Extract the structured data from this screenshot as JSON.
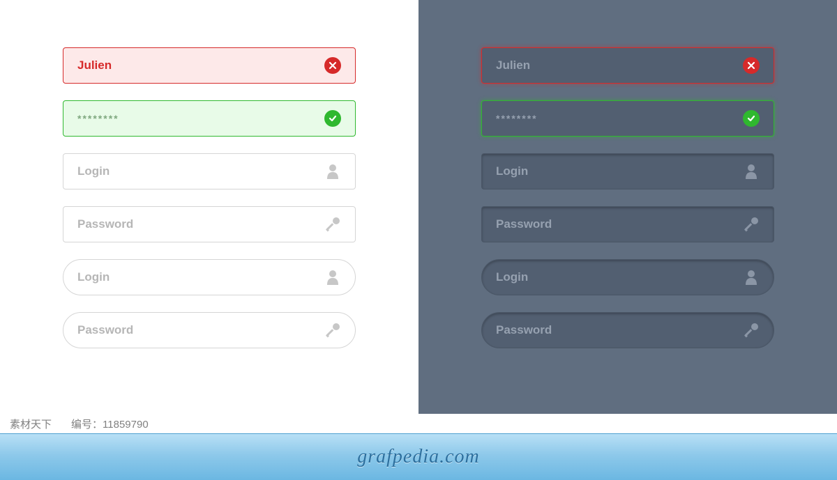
{
  "light_panel": {
    "fields": [
      {
        "value": "Julien",
        "type": "error",
        "icon": "x-icon",
        "shape": "rect"
      },
      {
        "value": "********",
        "type": "success",
        "icon": "check-icon",
        "shape": "rect"
      },
      {
        "value": "Login",
        "type": "neutral",
        "icon": "user-icon",
        "shape": "rect"
      },
      {
        "value": "Password",
        "type": "neutral",
        "icon": "key-icon",
        "shape": "rect"
      },
      {
        "value": "Login",
        "type": "neutral",
        "icon": "user-icon",
        "shape": "round"
      },
      {
        "value": "Password",
        "type": "neutral",
        "icon": "key-icon",
        "shape": "round"
      }
    ]
  },
  "dark_panel": {
    "fields": [
      {
        "value": "Julien",
        "type": "error",
        "icon": "x-icon",
        "shape": "rect"
      },
      {
        "value": "********",
        "type": "success",
        "icon": "check-icon",
        "shape": "rect"
      },
      {
        "value": "Login",
        "type": "neutral",
        "icon": "user-icon",
        "shape": "rect"
      },
      {
        "value": "Password",
        "type": "neutral",
        "icon": "key-icon",
        "shape": "rect"
      },
      {
        "value": "Login",
        "type": "neutral",
        "icon": "user-icon",
        "shape": "round"
      },
      {
        "value": "Password",
        "type": "neutral",
        "icon": "key-icon",
        "shape": "round"
      }
    ]
  },
  "meta": {
    "source_label": "素材天下",
    "id_label": "编号：",
    "id_value": "11859790"
  },
  "footer": {
    "brand": "grafpedia.com"
  }
}
